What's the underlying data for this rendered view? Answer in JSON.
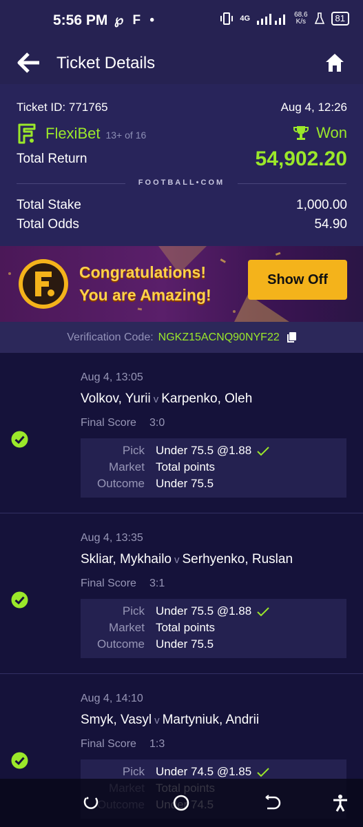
{
  "status_bar": {
    "time": "5:56 PM",
    "left_icons": "℘ F •",
    "network": "4G",
    "speed_value": "68.6",
    "speed_unit": "K/s",
    "battery": "81"
  },
  "header": {
    "title": "Ticket Details"
  },
  "ticket": {
    "id_label": "Ticket ID: 771765",
    "date": "Aug 4, 12:26",
    "brand": "FlexiBet",
    "count": "13+ of 16",
    "status": "Won",
    "total_return_label": "Total Return",
    "total_return_value": "54,902.20",
    "brand_mark": "FOOTBALL•COM",
    "total_stake_label": "Total Stake",
    "total_stake_value": "1,000.00",
    "total_odds_label": "Total Odds",
    "total_odds_value": "54.90"
  },
  "banner": {
    "line1": "Congratulations!",
    "line2": "You are Amazing!",
    "button": "Show Off"
  },
  "verification": {
    "label": "Verification Code:",
    "code": "NGKZ15ACNQ90NYF22"
  },
  "labels": {
    "final_score": "Final Score",
    "pick": "Pick",
    "market": "Market",
    "outcome": "Outcome",
    "vs": "v"
  },
  "matches": [
    {
      "time": "Aug 4, 13:05",
      "home": "Volkov, Yurii",
      "away": "Karpenko, Oleh",
      "score": "3:0",
      "pick": "Under 75.5 @1.88",
      "market": "Total points",
      "outcome": "Under 75.5"
    },
    {
      "time": "Aug 4, 13:35",
      "home": "Skliar, Mykhailo",
      "away": "Serhyenko, Ruslan",
      "score": "3:1",
      "pick": "Under 75.5 @1.88",
      "market": "Total points",
      "outcome": "Under 75.5"
    },
    {
      "time": "Aug 4, 14:10",
      "home": "Smyk, Vasyl",
      "away": "Martyniuk, Andrii",
      "score": "1:3",
      "pick": "Under 74.5 @1.85",
      "market": "Total points",
      "outcome": "Under 74.5"
    }
  ],
  "colors": {
    "accent": "#9be82a",
    "background": "#15123a",
    "header": "#262252",
    "button": "#f4b31b"
  }
}
